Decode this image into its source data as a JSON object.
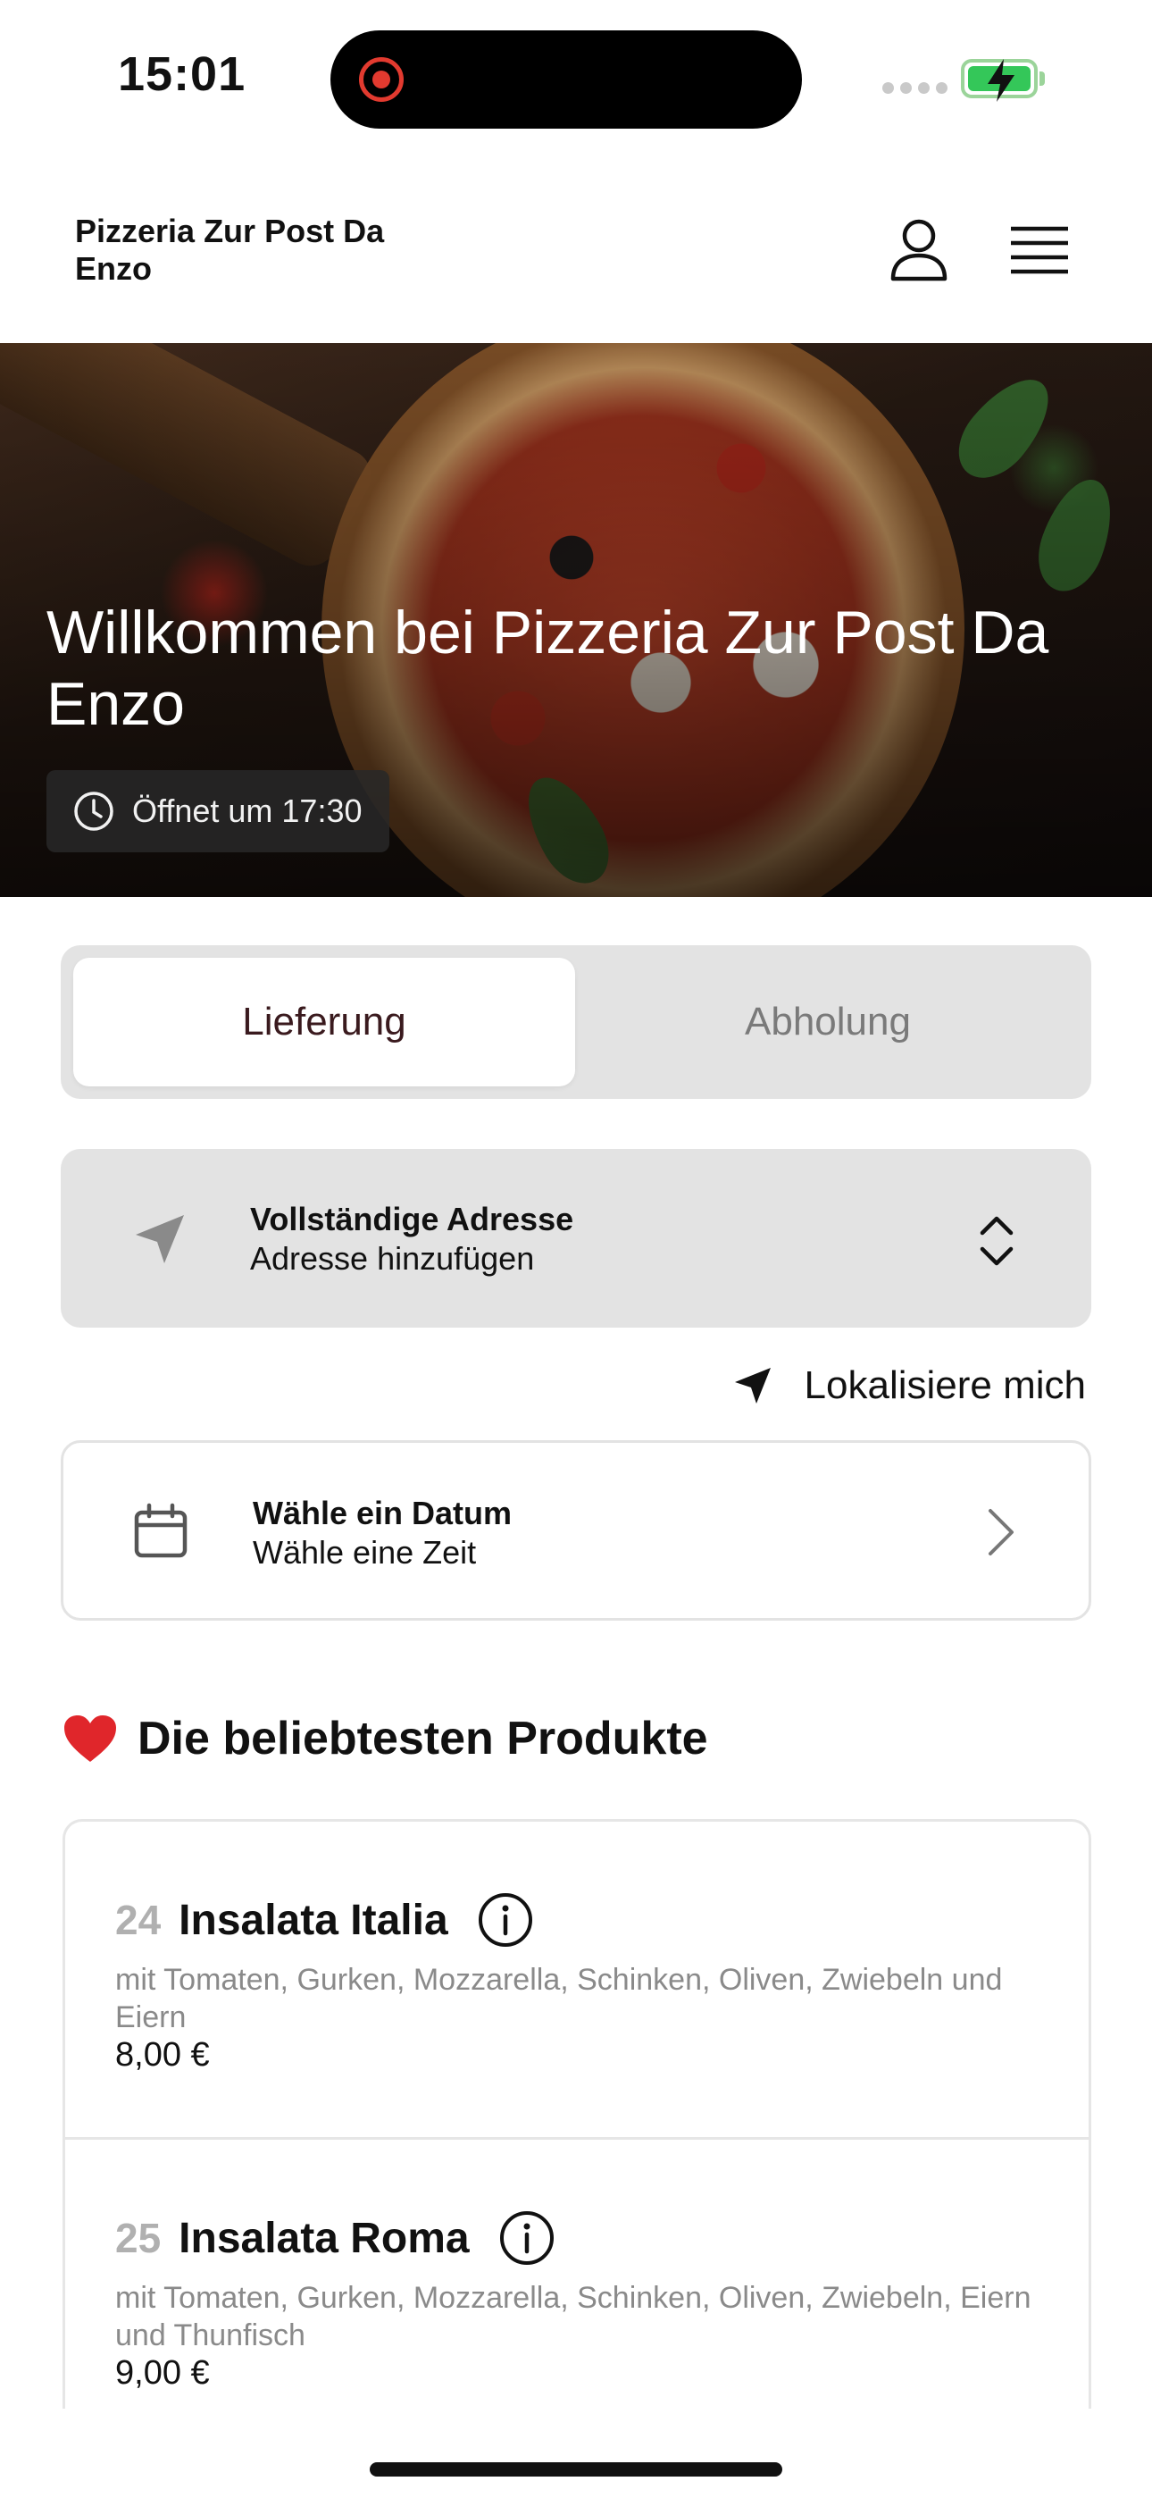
{
  "status_bar": {
    "time": "15:01"
  },
  "header": {
    "restaurant_name": "Pizzeria Zur Post Da Enzo"
  },
  "hero": {
    "title": "Willkommen bei Pizzeria Zur Post Da Enzo",
    "opening_status": "Öffnet um 17:30"
  },
  "order_mode": {
    "tabs": [
      {
        "label": "Lieferung",
        "active": true
      },
      {
        "label": "Abholung",
        "active": false
      }
    ]
  },
  "address": {
    "title": "Vollständige Adresse",
    "subtitle": "Adresse hinzufügen",
    "locate_label": "Lokalisiere mich"
  },
  "schedule": {
    "title": "Wähle ein Datum",
    "subtitle": "Wähle eine Zeit"
  },
  "popular": {
    "title": "Die beliebtesten Produkte",
    "products": [
      {
        "number": "24",
        "name": "Insalata Italia",
        "description": "mit Tomaten, Gurken, Mozzarella, Schinken, Oliven, Zwiebeln und Eiern",
        "price": "8,00 €"
      },
      {
        "number": "25",
        "name": "Insalata Roma",
        "description": "mit Tomaten, Gurken, Mozzarella, Schinken, Oliven, Zwiebeln, Eiern und Thunfisch",
        "price": "9,00 €"
      }
    ]
  },
  "colors": {
    "accent_text": "#3a1a1e",
    "segment_bg": "#e3e3e3",
    "battery_green": "#34c759",
    "recording_red": "#e23a2f"
  }
}
